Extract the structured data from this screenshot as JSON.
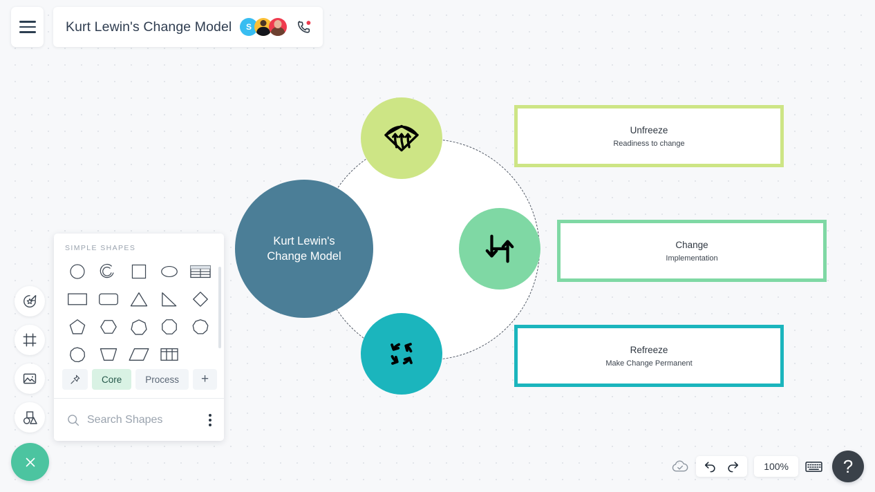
{
  "app": {
    "title": "Kurt Lewin's Change Model",
    "menu_icon": "hamburger-menu-icon",
    "call_icon": "phone-call-icon",
    "collaborators": [
      {
        "initial": "S",
        "color": "#38bdf1",
        "name": "collaborator-avatar-s"
      },
      {
        "initial": "",
        "color": "#fbbf35",
        "name": "collaborator-avatar-2"
      },
      {
        "initial": "",
        "color": "#ef3b4e",
        "name": "collaborator-avatar-3"
      }
    ]
  },
  "left_rail": {
    "items": [
      {
        "icon": "magic-star-icon",
        "label": "Smart shapes"
      },
      {
        "icon": "frame-icon",
        "label": "Frame"
      },
      {
        "icon": "image-icon",
        "label": "Image"
      },
      {
        "icon": "shapes-icon",
        "label": "Shapes"
      }
    ]
  },
  "shapes_panel": {
    "heading": "SIMPLE SHAPES",
    "shapes": [
      "circle",
      "arc",
      "square",
      "ellipse",
      "table-striped",
      "rectangle",
      "rounded-rectangle",
      "triangle",
      "right-triangle",
      "diamond",
      "pentagon",
      "hexagon",
      "heptagon",
      "octagon",
      "nonagon",
      "decagon",
      "trapezoid",
      "parallelogram",
      "grid-table"
    ],
    "tabs": [
      {
        "label": "",
        "icon": "pin-icon",
        "active": false
      },
      {
        "label": "Core",
        "active": true
      },
      {
        "label": "Process",
        "active": false
      },
      {
        "label": "+",
        "active": false
      }
    ],
    "search": {
      "placeholder": "Search Shapes",
      "icon": "search-icon"
    },
    "more_icon": "kebab-menu-icon"
  },
  "diagram": {
    "hub": {
      "line1": "Kurt Lewin's",
      "line2": "Change Model",
      "color": "#4b7e97"
    },
    "nodes": [
      {
        "id": "unfreeze",
        "icon": "defrost-icon",
        "color": "#cde585"
      },
      {
        "id": "change",
        "icon": "zigzag-arrows-icon",
        "color": "#7fd8a4"
      },
      {
        "id": "refreeze",
        "icon": "recycle-loop-icon",
        "color": "#1bb5bd"
      }
    ],
    "cards": [
      {
        "id": "unfreeze",
        "title": "Unfreeze",
        "subtitle": "Readiness to change",
        "color": "#cde585"
      },
      {
        "id": "change",
        "title": "Change",
        "subtitle": "Implementation",
        "color": "#7fd8a4"
      },
      {
        "id": "refreeze",
        "title": "Refreeze",
        "subtitle": "Make Change Permanent",
        "color": "#1bb5bd"
      }
    ]
  },
  "bottom_bar": {
    "close_icon": "close-x-icon",
    "save_status_icon": "cloud-saved-icon",
    "undo_icon": "undo-icon",
    "redo_icon": "redo-icon",
    "zoom_level": "100%",
    "keyboard_icon": "keyboard-icon",
    "help_label": "?"
  }
}
